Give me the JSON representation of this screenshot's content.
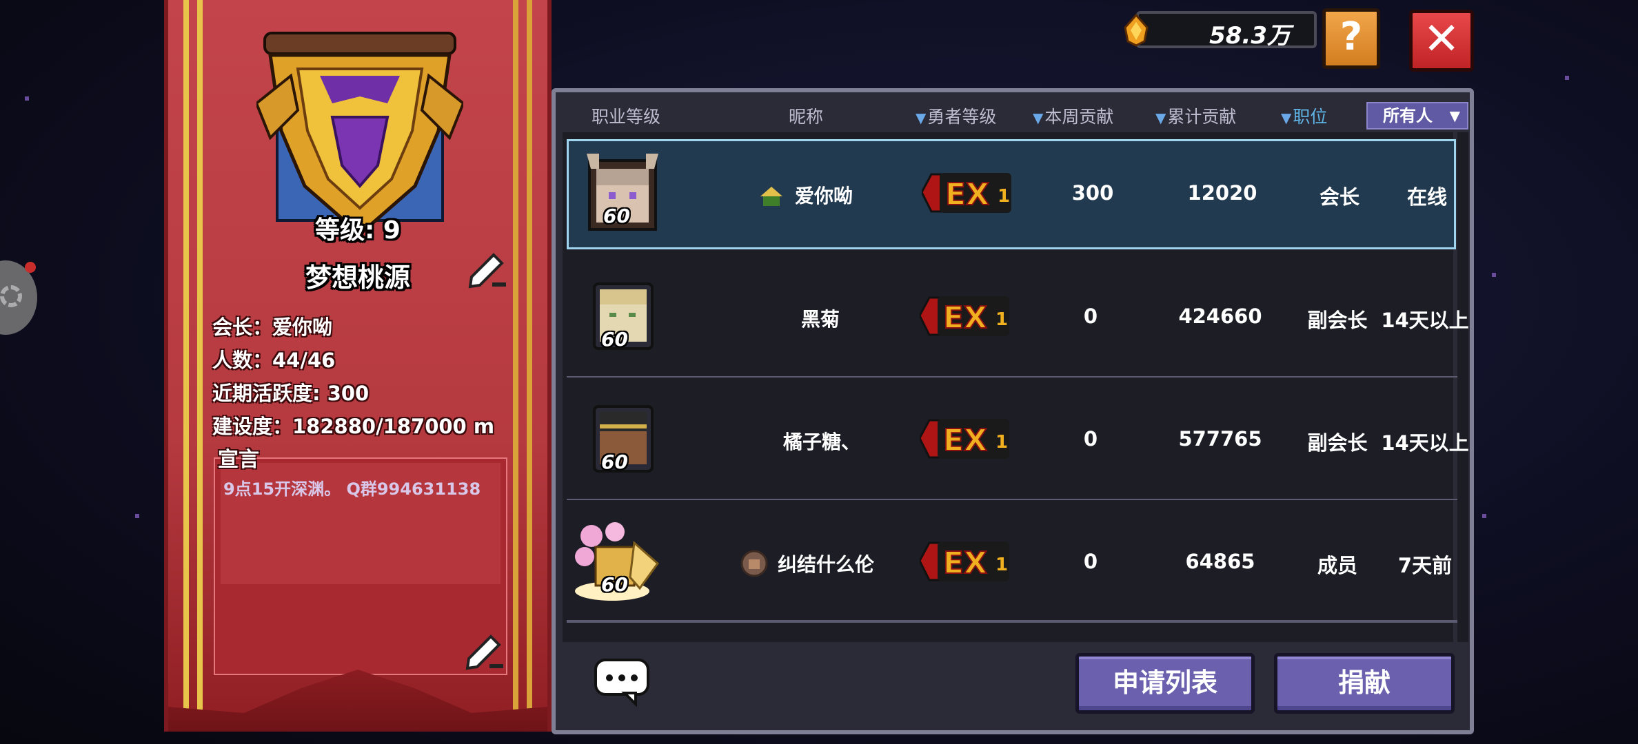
{
  "top_bar": {
    "currency_value": "58.3万",
    "help_label": "?",
    "close_label": "✕",
    "coin_icon": "flame-gem-icon"
  },
  "guild": {
    "level_text": "等级: 9",
    "name": "梦想桃源",
    "leader": "会长：爱你呦",
    "members": "人数：44/46",
    "activity": "近期活跃度: 300",
    "construction": "建设度：182880/187000 m",
    "declaration_label": "宣言",
    "declaration": "9点15开深渊。 Q群994631138"
  },
  "table": {
    "headers": {
      "class_level": "职业等级",
      "nickname": "昵称",
      "hero_level": "勇者等级",
      "weekly": "本周贡献",
      "total": "累计贡献",
      "position": "职位"
    },
    "filter": "所有人",
    "rows": [
      {
        "level": "60",
        "nick": "爱你呦",
        "weekly": "300",
        "total": "12020",
        "role": "会长",
        "status": "在线",
        "badge": "EX1"
      },
      {
        "level": "60",
        "nick": "黑菊",
        "weekly": "0",
        "total": "424660",
        "role": "副会长",
        "status": "14天以上",
        "badge": "EX1"
      },
      {
        "level": "60",
        "nick": "橘子糖、",
        "weekly": "0",
        "total": "577765",
        "role": "副会长",
        "status": "14天以上",
        "badge": "EX1"
      },
      {
        "level": "60",
        "nick": "纠结什么伦",
        "weekly": "0",
        "total": "64865",
        "role": "成员",
        "status": "7天前",
        "badge": "EX1"
      }
    ]
  },
  "actions": {
    "apply_list": "申请列表",
    "donate": "捐献"
  }
}
